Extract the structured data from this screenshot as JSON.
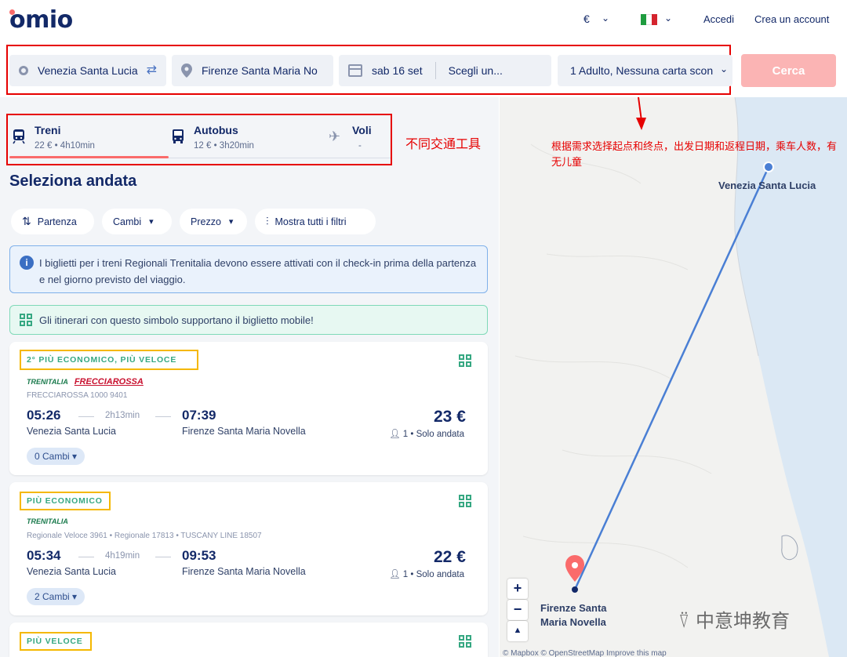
{
  "header": {
    "logo": "omio",
    "currency": "€",
    "accedi": "Accedi",
    "signup": "Crea un account"
  },
  "search": {
    "origin": "Venezia Santa Lucia",
    "destination": "Firenze Santa Maria No",
    "depart_date": "sab 16 set",
    "return_date": "Scegli un...",
    "passengers": "1 Adulto, Nessuna carta scon",
    "submit": "Cerca"
  },
  "tabs": [
    {
      "name": "Treni",
      "sub": "22 € • 4h10min"
    },
    {
      "name": "Autobus",
      "sub": "12 € • 3h20min"
    },
    {
      "name": "Voli",
      "sub": "-"
    }
  ],
  "annotations": {
    "tabs": "不同交通工具",
    "search": "根据需求选择起点和终点，出发日期和返程日期，乘车人数，有无儿童"
  },
  "heading": "Seleziona andata",
  "filters": [
    "Partenza",
    "Cambi",
    "Prezzo",
    "Mostra tutti i filtri"
  ],
  "info": "I biglietti per i treni Regionali Trenitalia devono essere attivati con il check-in prima della partenza e nel giorno previsto del viaggio.",
  "mobile": "Gli itinerari con questo simbolo supportano il biglietto mobile!",
  "results": [
    {
      "badge": "2° PIÙ ECONOMICO,  PIÙ VELOCE",
      "brand1": "TRENITALIA",
      "brand2": "FRECCIAROSSA",
      "code": "FRECCIAROSSA 1000 9401",
      "dep": "05:26",
      "duration": "2h13min",
      "arr": "07:39",
      "from": "Venezia Santa Lucia",
      "to": "Firenze Santa Maria Novella",
      "price": "23 €",
      "pax": "1 • Solo andata",
      "cambi": "0 Cambi"
    },
    {
      "badge": "PIÙ ECONOMICO",
      "brand1": "TRENITALIA",
      "code": "Regionale Veloce 3961 • Regionale 17813 • TUSCANY LINE 18507",
      "dep": "05:34",
      "duration": "4h19min",
      "arr": "09:53",
      "from": "Venezia Santa Lucia",
      "to": "Firenze Santa Maria Novella",
      "price": "22 €",
      "pax": "1 • Solo andata",
      "cambi": "2 Cambi"
    },
    {
      "badge": "PIÙ VELOCE"
    }
  ],
  "map": {
    "origin_label": "Venezia Santa Lucia",
    "dest_label_1": "Firenze Santa",
    "dest_label_2": "Maria Novella",
    "zoom_in": "+",
    "zoom_out": "−",
    "compass": "▲",
    "attribution": "© Mapbox © OpenStreetMap  Improve this map"
  },
  "watermark": "中意坤教育",
  "colors": {
    "brand": "#132968",
    "accent": "#fa6b6b",
    "annotation": "#e60000",
    "badge_green": "#36a882",
    "badge_frame": "#f5b800",
    "route": "#4a7fd4"
  }
}
